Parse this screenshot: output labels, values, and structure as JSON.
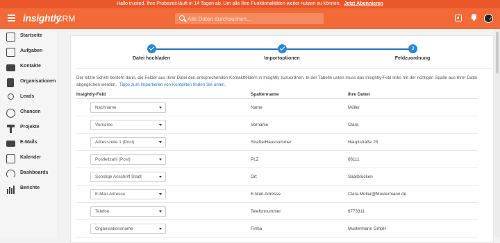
{
  "banner": {
    "text": "Hallo trusted. Ihre Probezeit läuft in 14 Tagen ab. Um alle Ihre Funktionalitäten weiter nutzen zu können,",
    "link": "Jetzt Abonnieren"
  },
  "header": {
    "logo": "insightly",
    "product": "CRM",
    "search_placeholder": "Alle Daten durchsuchen..."
  },
  "sidebar": {
    "items": [
      {
        "label": "Startseite",
        "icon": "building-icon"
      },
      {
        "label": "Aufgaben",
        "icon": "checkbox-icon"
      },
      {
        "label": "Kontakte",
        "icon": "contact-card-icon"
      },
      {
        "label": "Organisationen",
        "icon": "organization-icon"
      },
      {
        "label": "Leads",
        "icon": "leads-icon"
      },
      {
        "label": "Chancen",
        "icon": "target-icon"
      },
      {
        "label": "Projekte",
        "icon": "hammer-icon"
      },
      {
        "label": "E-Mails",
        "icon": "mail-icon"
      },
      {
        "label": "Kalender",
        "icon": "calendar-icon"
      },
      {
        "label": "Dashboards",
        "icon": "dashboard-icon"
      },
      {
        "label": "Berichte",
        "icon": "reports-icon"
      }
    ]
  },
  "stepper": {
    "steps": [
      {
        "label": "Datei hochladen",
        "state": "done"
      },
      {
        "label": "Importoptionen",
        "state": "done"
      },
      {
        "label": "Feldzuordnung",
        "state": "active",
        "number": "3"
      }
    ]
  },
  "instructions": {
    "text": "Der letzte Schritt besteht darin, die Felder aus Ihrer Datei den entsprechenden Kontaktfeldern in Insightly zuzuordnen. In der Tabelle unten muss das Insightly-Feld links mit der richtigen Spalte aus Ihrer Datei abgeglichen werden.",
    "tips_link": "Tipps zum Importieren von Kontakten finden Sie unten."
  },
  "table": {
    "headers": [
      "Insightly-Feld",
      "Spaltenname",
      "Ihre Daten"
    ],
    "rows": [
      {
        "field": "Nachname",
        "column": "Name",
        "data": "Müller"
      },
      {
        "field": "Vorname",
        "column": "Vorname",
        "data": "Clara"
      },
      {
        "field": "Adresszeile 1 (Post)",
        "column": "Straße/Hausnummer",
        "data": "Hauptstraße 25"
      },
      {
        "field": "Postleitzahl (Post)",
        "column": "PLZ",
        "data": "66111"
      },
      {
        "field": "Sonstige Anschrift Stadt",
        "column": "Ort",
        "data": "Saarbrücken"
      },
      {
        "field": "E-Mail-Adresse",
        "column": "E-Mail-Adresse",
        "data": "Clara.Müller@Mustermann.de"
      },
      {
        "field": "Telefon",
        "column": "Telefonnummer",
        "data": "6773311"
      },
      {
        "field": "Organisationsname",
        "column": "Firma",
        "data": "Mustermann GmbH"
      }
    ]
  },
  "colors": {
    "brand": "#f26a37",
    "banner": "#e8572a",
    "step": "#2a86d3"
  }
}
